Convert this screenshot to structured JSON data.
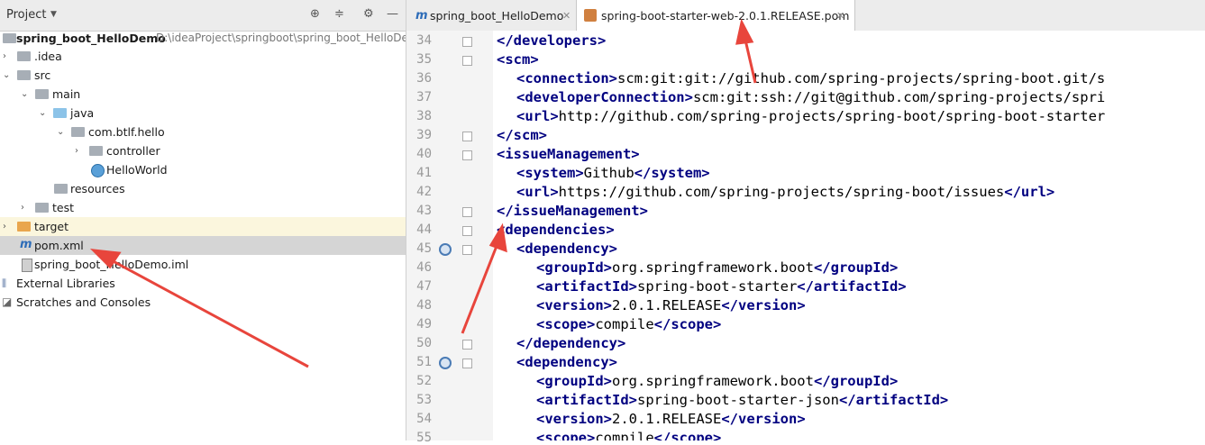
{
  "project_panel": {
    "title": "Project",
    "items": [
      {
        "label": "spring_boot_HelloDemo",
        "path": "D:\\ideaProject\\springboot\\spring_boot_HelloDe"
      },
      {
        "label": ".idea"
      },
      {
        "label": "src"
      },
      {
        "label": "main"
      },
      {
        "label": "java"
      },
      {
        "label": "com.btlf.hello"
      },
      {
        "label": "controller"
      },
      {
        "label": "HelloWorld"
      },
      {
        "label": "resources"
      },
      {
        "label": "test"
      },
      {
        "label": "target"
      },
      {
        "label": "pom.xml"
      },
      {
        "label": "spring_boot_HelloDemo.iml"
      },
      {
        "label": "External Libraries"
      },
      {
        "label": "Scratches and Consoles"
      }
    ]
  },
  "tabs": [
    {
      "label": "spring_boot_HelloDemo"
    },
    {
      "label": "spring-boot-starter-web-2.0.1.RELEASE.pom"
    }
  ],
  "editor": {
    "lines": [
      {
        "num": "34",
        "open": "</developers>"
      },
      {
        "num": "35",
        "open": "<scm>"
      },
      {
        "num": "36",
        "open": "<connection>",
        "text": "scm:git:git://github.com/spring-projects/spring-boot.git/s"
      },
      {
        "num": "37",
        "open": "<developerConnection>",
        "text": "scm:git:ssh://git@github.com/spring-projects/spri"
      },
      {
        "num": "38",
        "open": "<url>",
        "text": "http://github.com/spring-projects/spring-boot/spring-boot-starter"
      },
      {
        "num": "39",
        "open": "</scm>"
      },
      {
        "num": "40",
        "open": "<issueManagement>"
      },
      {
        "num": "41",
        "open": "<system>",
        "text": "Github",
        "close": "</system>"
      },
      {
        "num": "42",
        "open": "<url>",
        "text": "https://github.com/spring-projects/spring-boot/issues",
        "close": "</url>"
      },
      {
        "num": "43",
        "open": "</issueManagement>"
      },
      {
        "num": "44",
        "open": "<dependencies>"
      },
      {
        "num": "45",
        "open": "<dependency>"
      },
      {
        "num": "46",
        "open": "<groupId>",
        "text": "org.springframework.boot",
        "close": "</groupId>"
      },
      {
        "num": "47",
        "open": "<artifactId>",
        "text": "spring-boot-starter",
        "close": "</artifactId>"
      },
      {
        "num": "48",
        "open": "<version>",
        "text": "2.0.1.RELEASE",
        "close": "</version>"
      },
      {
        "num": "49",
        "open": "<scope>",
        "text": "compile",
        "close": "</scope>"
      },
      {
        "num": "50",
        "open": "</dependency>"
      },
      {
        "num": "51",
        "open": "<dependency>"
      },
      {
        "num": "52",
        "open": "<groupId>",
        "text": "org.springframework.boot",
        "close": "</groupId>"
      },
      {
        "num": "53",
        "open": "<artifactId>",
        "text": "spring-boot-starter-json",
        "close": "</artifactId>"
      },
      {
        "num": "54",
        "open": "<version>",
        "text": "2.0.1.RELEASE",
        "close": "</version>"
      },
      {
        "num": "55",
        "open": "<scope>",
        "text": "compile",
        "close": "</scope>"
      }
    ]
  },
  "colors": {
    "tag": "#000080",
    "annotation_arrow": "#e8453c",
    "selection": "#d5d5d5"
  }
}
